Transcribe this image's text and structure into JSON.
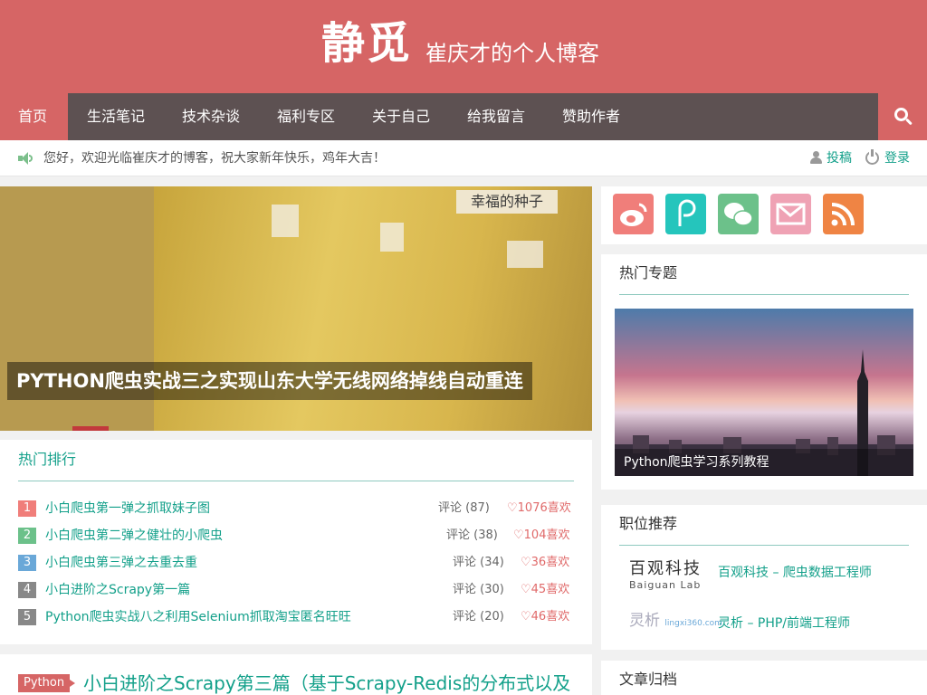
{
  "header": {
    "logo": "静觅",
    "slogan": "崔庆才的个人博客"
  },
  "nav": {
    "home": "首页",
    "items": [
      "生活笔记",
      "技术杂谈",
      "福利专区",
      "关于自己",
      "给我留言",
      "赞助作者"
    ],
    "search_icon": "search-icon"
  },
  "notice": {
    "text": "您好，欢迎光临崔庆才的博客，祝大家新年快乐，鸡年大吉！",
    "submit": "投稿",
    "login": "登录"
  },
  "hero": {
    "title": "PYTHON爬虫实战三之实现山东大学无线网络掉线自动重连",
    "sign": "幸福的种子"
  },
  "hot_ranking": {
    "title": "热门排行",
    "items": [
      {
        "num": "1",
        "title": "小白爬虫第一弹之抓取妹子图",
        "comments": "评论 (87)",
        "likes": "♡1076喜欢",
        "color": "#f07e7a"
      },
      {
        "num": "2",
        "title": "小白爬虫第二弹之健壮的小爬虫",
        "comments": "评论 (38)",
        "likes": "♡104喜欢",
        "color": "#6cc18a"
      },
      {
        "num": "3",
        "title": "小白爬虫第三弹之去重去重",
        "comments": "评论 (34)",
        "likes": "♡36喜欢",
        "color": "#6aa8d8"
      },
      {
        "num": "4",
        "title": "小白进阶之Scrapy第一篇",
        "comments": "评论 (30)",
        "likes": "♡45喜欢",
        "color": "#888888"
      },
      {
        "num": "5",
        "title": "Python爬虫实战八之利用Selenium抓取淘宝匿名旺旺",
        "comments": "评论 (20)",
        "likes": "♡46喜欢",
        "color": "#888888"
      }
    ]
  },
  "post": {
    "tag": "Python",
    "title": "小白进阶之Scrapy第三篇（基于Scrapy-Redis的分布式以及"
  },
  "sidebar": {
    "social": [
      "weibo-icon",
      "p-icon",
      "wechat-icon",
      "mail-icon",
      "rss-icon"
    ],
    "topics": {
      "title": "热门专题",
      "caption": "Python爬虫学习系列教程"
    },
    "jobs": {
      "title": "职位推荐",
      "items": [
        {
          "logo_cn": "百观科技",
          "logo_en": "Baiguan Lab",
          "link": "百观科技 – 爬虫数据工程师"
        },
        {
          "logo_cn": "灵析",
          "logo_en": "lingxi360.com",
          "link": "灵析 – PHP/前端工程师"
        }
      ]
    },
    "archive": {
      "title": "文章归档"
    }
  },
  "colors": {
    "brand": "#d66565",
    "nav_dark": "#5d5152",
    "link": "#13a08a",
    "like": "#e06a6a"
  }
}
